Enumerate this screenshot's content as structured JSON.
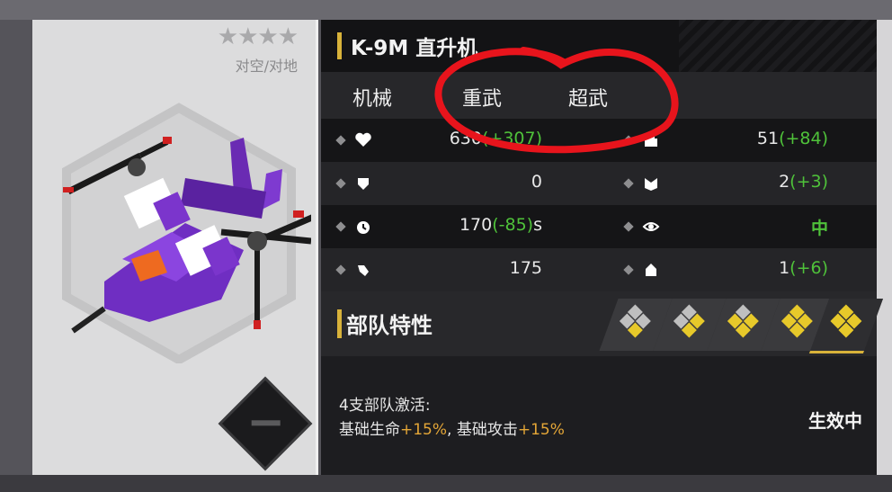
{
  "unit": {
    "stars": "★★★★",
    "role": "对空/对地",
    "name": "K-9M 直升机",
    "tags": [
      "机械",
      "重武",
      "超武"
    ]
  },
  "stats": {
    "hp": {
      "base": "630",
      "bonus": "(+307)"
    },
    "attack": {
      "base": "51",
      "bonus": "(+84)"
    },
    "armor": {
      "base": "0",
      "bonus": ""
    },
    "population": {
      "base": "2",
      "bonus": "(+3)"
    },
    "cooldown": {
      "base": "170",
      "bonus": "(-85)",
      "unit": "s"
    },
    "vision": {
      "value": "中"
    },
    "speed": {
      "base": "175",
      "bonus": ""
    },
    "count": {
      "base": "1",
      "bonus": "(+6)"
    }
  },
  "traits": {
    "title": "部队特性",
    "tiers": 5,
    "active_tier": 5,
    "desc_line1": "4支部队激活:",
    "desc_line2": {
      "a": "基础生命",
      "b": "+15%",
      "c": ", 基础攻击",
      "d": "+15%"
    },
    "status": "生效中"
  },
  "colors": {
    "accent": "#d8b23a",
    "bonus_green": "#4fc23a",
    "highlight_orange": "#e4a637",
    "annotation_red": "#e8141c"
  }
}
